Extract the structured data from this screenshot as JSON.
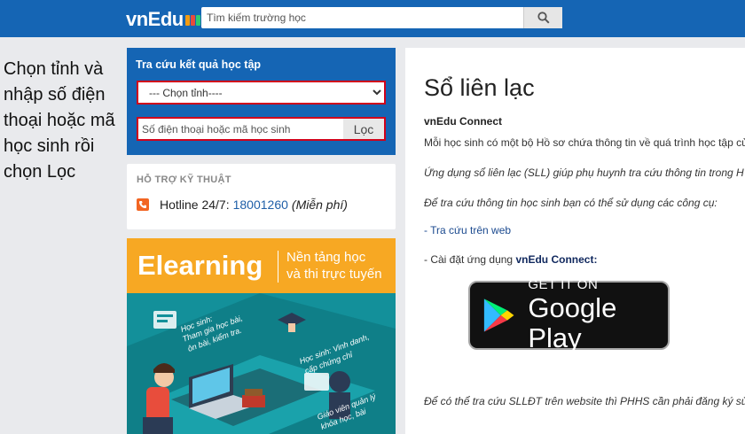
{
  "header": {
    "logo_text": "vnEdu",
    "search_placeholder": "Tìm kiếm trường học",
    "search_icon": "search-icon"
  },
  "annotation": {
    "text": "Chọn tỉnh và nhập số điện thoại hoặc mã học sinh rồi chọn Lọc"
  },
  "lookup": {
    "title": "Tra cứu kết quả học tập",
    "province_selected": "--- Chọn tỉnh----",
    "phone_placeholder": "Số điện thoại hoặc mã học sinh",
    "filter_label": "Lọc"
  },
  "support": {
    "title": "HỖ TRỢ KỸ THUẬT",
    "hotline_label": "Hotline 24/7:",
    "hotline_number": "18001260",
    "hotline_note": "(Miễn phí)",
    "icon": "phone-icon"
  },
  "banner": {
    "title": "Elearning",
    "subtitle_line1": "Nền tảng học",
    "subtitle_line2": "và thi trực tuyến"
  },
  "main": {
    "title": "Sổ liên lạc",
    "section": "vnEdu Connect",
    "para1": "Mỗi học sinh có một bộ Hồ sơ chứa thông tin về quá trình học tập củ",
    "para2": "Ứng dụng sổ liên lạc (SLL) giúp phụ huynh tra cứu thông tin trong H",
    "para3": "Để tra cứu thông tin học sinh bạn có thể sử dụng các công cụ:",
    "link_web": "- Tra cứu trên web",
    "install_prefix": "- Cài đặt ứng dụng",
    "install_app": "vnEdu Connect:",
    "gplay_small": "GET IT ON",
    "gplay_big": "Google Play",
    "para_last": "Để có thể tra cứu SLLĐT trên website thì PHHS cần phải đăng ký sử"
  },
  "colors": {
    "header_bg": "#1565b4",
    "highlight_border": "#d0021b",
    "banner_orange": "#f7a823",
    "banner_teal": "#13909a",
    "link": "#1b4a8f"
  }
}
